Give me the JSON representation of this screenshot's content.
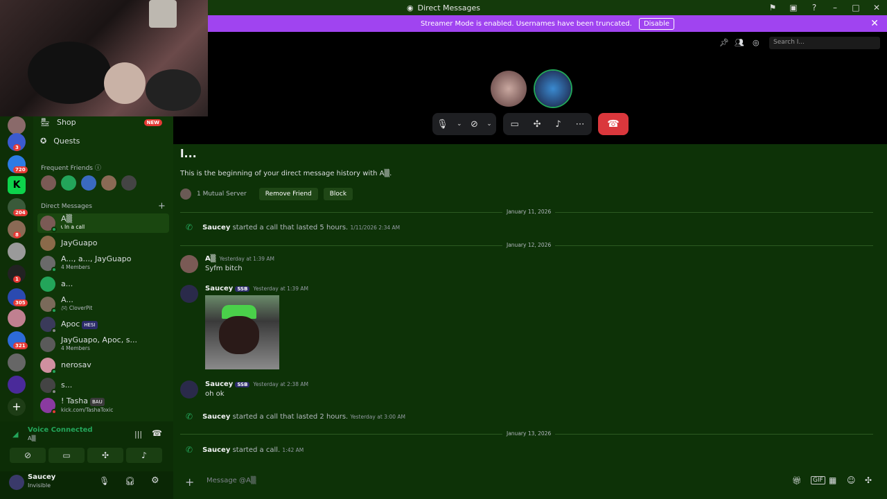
{
  "window": {
    "title": "Direct Messages"
  },
  "banner": {
    "text": "Streamer Mode is enabled. Usernames have been truncated.",
    "button": "Disable"
  },
  "guild_badges": [
    "3",
    "720",
    "204",
    "8",
    "1",
    "305",
    "321"
  ],
  "sidebar": {
    "shop": "Shop",
    "shop_badge": "NEW",
    "quests": "Quests",
    "frequent_friends": "Frequent Friends",
    "direct_messages": "Direct Messages",
    "add": "+",
    "dms": [
      {
        "name": "A▒",
        "sub": "In a call"
      },
      {
        "name": "JayGuapo",
        "sub": ""
      },
      {
        "name": "A..., a..., JayGuapo",
        "sub": "4 Members"
      },
      {
        "name": "a...",
        "sub": ""
      },
      {
        "name": "A...",
        "sub": "CloverPit"
      },
      {
        "name": "Apoc",
        "sub": "",
        "tag": "HESI"
      },
      {
        "name": "JayGuapo, Apoc, s...",
        "sub": "4 Members"
      },
      {
        "name": "nerosav",
        "sub": ""
      },
      {
        "name": "s...",
        "sub": ""
      },
      {
        "name": "! Tasha",
        "sub": "kick.com/TashaToxic",
        "tag": "BAU"
      }
    ]
  },
  "voice": {
    "status": "Voice Connected",
    "channel": "A▒"
  },
  "user": {
    "name": "Saucey",
    "status": "Invisible"
  },
  "call": {
    "search_placeholder": "Search I..."
  },
  "chat": {
    "header": "l...",
    "intro": "This is the beginning of your direct message history with A▒.",
    "mutual": "1 Mutual Server",
    "remove_friend": "Remove Friend",
    "block": "Block",
    "date1": "January 11, 2026",
    "sys1_name": "Saucey",
    "sys1_text": "started a call that lasted 5 hours.",
    "sys1_time": "1/11/2026 2:34 AM",
    "date2": "January 12, 2026",
    "m1_name": "A▒",
    "m1_time": "Yesterday at 1:39 AM",
    "m1_text": "Syfm bitch",
    "m2_name": "Saucey",
    "m2_tag": "SSB",
    "m2_time": "Yesterday at 1:39 AM",
    "m3_name": "Saucey",
    "m3_tag": "SSB",
    "m3_time": "Yesterday at 2:38 AM",
    "m3_text": "oh ok",
    "sys2_name": "Saucey",
    "sys2_text": "started a call that lasted 2 hours.",
    "sys2_time": "Yesterday at 3:00 AM",
    "date3": "January 13, 2026",
    "sys3_name": "Saucey",
    "sys3_text": "started a call.",
    "sys3_time": "1:42 AM",
    "composer_placeholder": "Message @A▒"
  },
  "colors": {
    "banner": "#a044f0",
    "hangup": "#da373c",
    "accent_green": "#23a55a"
  }
}
